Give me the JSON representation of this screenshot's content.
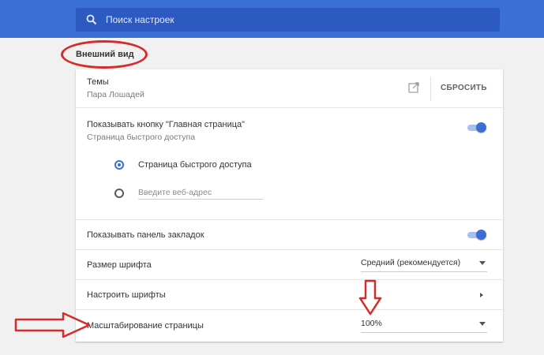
{
  "search": {
    "placeholder": "Поиск настроек"
  },
  "section": {
    "title": "Внешний вид"
  },
  "themes": {
    "label": "Темы",
    "value": "Пара Лошадей",
    "reset_label": "СБРОСИТЬ"
  },
  "home_button": {
    "label": "Показывать кнопку \"Главная страница\"",
    "sub": "Страница быстрого доступа",
    "enabled": true,
    "radio_option_1": "Страница быстрого доступа",
    "url_placeholder": "Введите веб-адрес"
  },
  "bookmarks_bar": {
    "label": "Показывать панель закладок",
    "enabled": true
  },
  "font_size": {
    "label": "Размер шрифта",
    "value": "Средний (рекомендуется)"
  },
  "customize_fonts": {
    "label": "Настроить шрифты"
  },
  "page_zoom": {
    "label": "Масштабирование страницы",
    "value": "100%"
  },
  "colors": {
    "accent": "#3b6fd6",
    "annotation": "#d62b2b"
  }
}
